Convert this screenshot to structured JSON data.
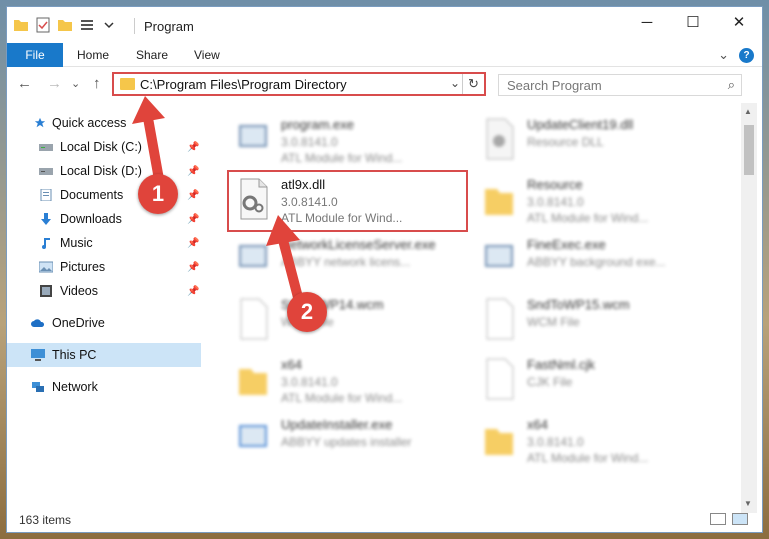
{
  "window": {
    "title": "Program",
    "controls": {
      "minimize": "─",
      "maximize": "☐",
      "close": "✕"
    }
  },
  "ribbon": {
    "tabs": [
      "File",
      "Home",
      "Share",
      "View"
    ],
    "collapse": "⌄",
    "help": "?"
  },
  "nav": {
    "back": "←",
    "forward": "→",
    "recent": "⌄",
    "up": "↑",
    "address": "C:\\Program Files\\Program Directory",
    "address_dropdown": "⌄",
    "refresh": "↻",
    "search_placeholder": "Search Program",
    "search_icon": "⌕"
  },
  "sidebar": {
    "items": [
      {
        "label": "Quick access",
        "icon": "star-icon",
        "pinned": false
      },
      {
        "label": "Local Disk (C:)",
        "icon": "drive-icon",
        "pinned": true
      },
      {
        "label": "Local Disk (D:)",
        "icon": "drive-icon",
        "pinned": true
      },
      {
        "label": "Documents",
        "icon": "documents-icon",
        "pinned": true
      },
      {
        "label": "Downloads",
        "icon": "download-icon",
        "pinned": true
      },
      {
        "label": "Music",
        "icon": "music-icon",
        "pinned": true
      },
      {
        "label": "Pictures",
        "icon": "pictures-icon",
        "pinned": true
      },
      {
        "label": "Videos",
        "icon": "videos-icon",
        "pinned": true
      },
      {
        "label": "OneDrive",
        "icon": "cloud-icon",
        "pinned": false
      },
      {
        "label": "This PC",
        "icon": "computer-icon",
        "pinned": false
      },
      {
        "label": "Network",
        "icon": "network-icon",
        "pinned": false
      }
    ],
    "pin_glyph": "📌"
  },
  "files": [
    {
      "name": "program.exe",
      "line2": "3.0.8141.0",
      "line3": "ATL Module for Wind...",
      "icon": "exe-icon"
    },
    {
      "name": "UpdateClient19.dll",
      "line2": "Resource DLL",
      "line3": "",
      "icon": "dll-icon"
    },
    {
      "name": "atl9x.dll",
      "line2": "3.0.8141.0",
      "line3": "ATL Module for Wind...",
      "icon": "dll-gear-icon"
    },
    {
      "name": "Resource",
      "line2": "3.0.8141.0",
      "line3": "ATL Module for Wind...",
      "icon": "folder-icon"
    },
    {
      "name": "NetworkLicenseServer.exe",
      "line2": "ABBYY network licens...",
      "line3": "",
      "icon": "exe-icon"
    },
    {
      "name": "FineExec.exe",
      "line2": "ABBYY background exe...",
      "line3": "",
      "icon": "exe-icon"
    },
    {
      "name": "SndToWP14.wcm",
      "line2": "WCM File",
      "line3": "",
      "icon": "file-icon"
    },
    {
      "name": "SndToWP15.wcm",
      "line2": "WCM File",
      "line3": "",
      "icon": "file-icon"
    },
    {
      "name": "x64",
      "line2": "3.0.8141.0",
      "line3": "ATL Module for Wind...",
      "icon": "folder-icon"
    },
    {
      "name": "FastNml.cjk",
      "line2": "CJK File",
      "line3": "",
      "icon": "file-icon"
    },
    {
      "name": "UpdateInstaller.exe",
      "line2": "ABBYY updates installer",
      "line3": "",
      "icon": "exe-icon"
    },
    {
      "name": "x64",
      "line2": "3.0.8141.0",
      "line3": "ATL Module for Wind...",
      "icon": "folder-icon"
    }
  ],
  "status": {
    "item_count": "163 items"
  },
  "markers": [
    "1",
    "2"
  ],
  "colors": {
    "accent": "#1979ca",
    "highlight": "#d84c4c",
    "marker": "#e0443b",
    "selected": "#cce4f7"
  }
}
